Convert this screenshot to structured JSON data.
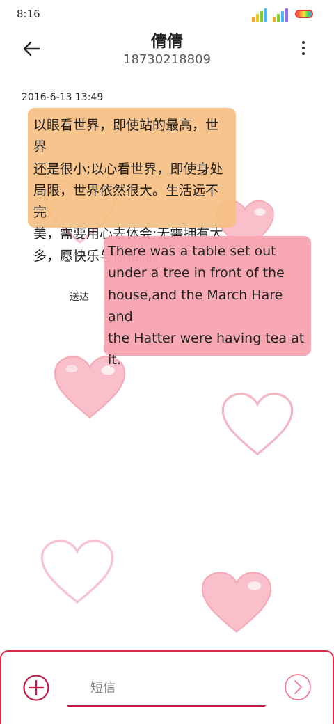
{
  "status_bar": {
    "time": "8:16",
    "signal_colors": [
      "#f5a623",
      "#f0c419",
      "#7ed321",
      "#4ab8f5",
      "#9b6bf2"
    ],
    "battery_level": 1.0
  },
  "header": {
    "back_icon": "arrow-left-icon",
    "title": "倩倩",
    "subtitle": "18730218809",
    "more_icon": "more-vertical-icon"
  },
  "conversation": {
    "timestamp": "2016-6-13 13:49",
    "incoming_lines": [
      "以眼看世界，即使站的最高，世界",
      "还是很小;以心看世界，即使身处",
      "局限，世界依然很大。生活远不完",
      "美，需要用心去体会;无需拥有太",
      "多，愿快乐与你相随。"
    ],
    "outgoing_lines": [
      "There was a table set out",
      "under a tree in front of the",
      "house,and the March Hare and",
      "the Hatter were having tea at",
      "it."
    ],
    "sent_status": "送达",
    "colors": {
      "incoming": "#f5bf82",
      "outgoing": "#f7a3af"
    }
  },
  "composer": {
    "add_icon": "plus-circle-icon",
    "placeholder": "短信",
    "value": "",
    "send_icon": "send-chevron-icon",
    "accent": "#c21a43"
  }
}
